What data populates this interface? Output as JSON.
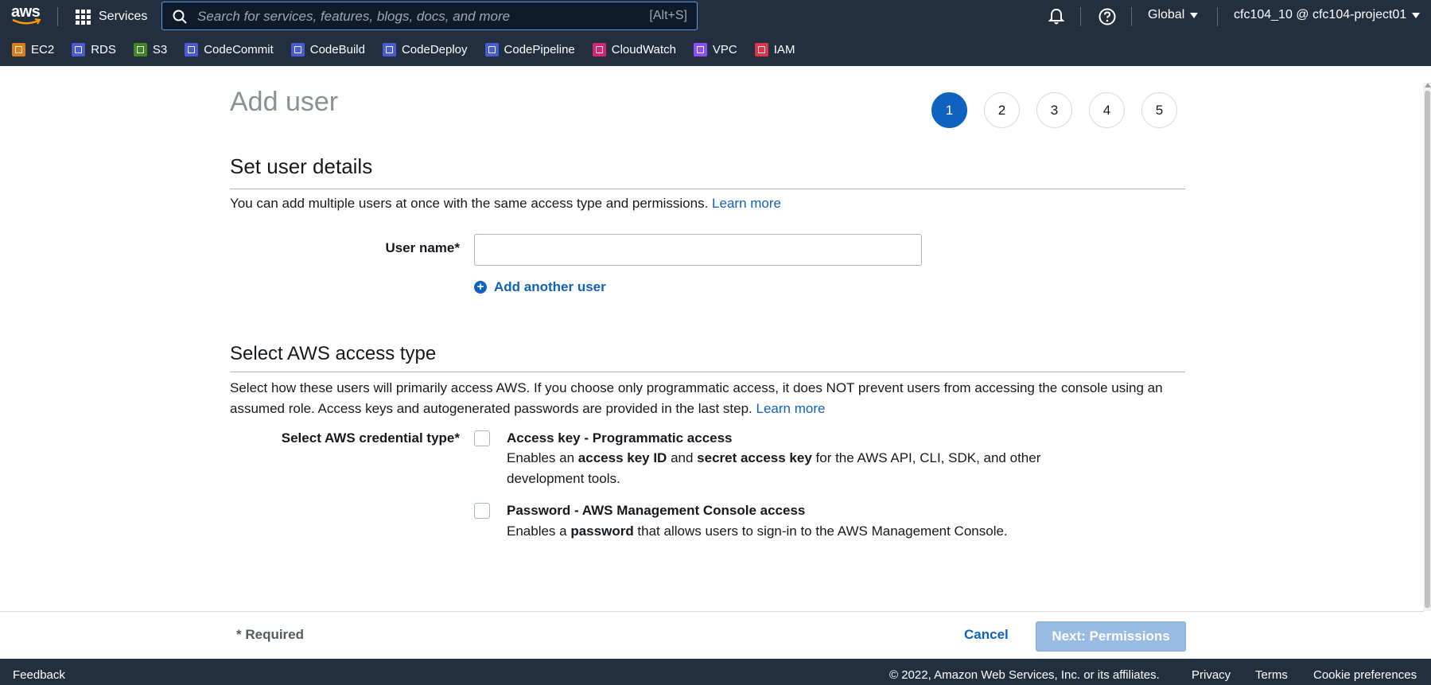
{
  "topnav": {
    "logo_text": "aws",
    "services_label": "Services",
    "search_placeholder": "Search for services, features, blogs, docs, and more",
    "search_shortcut": "[Alt+S]",
    "region": "Global",
    "account": "cfc104_10 @ cfc104-project01"
  },
  "favorites": [
    {
      "label": "EC2",
      "color": "#e07b1a"
    },
    {
      "label": "RDS",
      "color": "#4a5bd8"
    },
    {
      "label": "S3",
      "color": "#3f8624"
    },
    {
      "label": "CodeCommit",
      "color": "#4a5bd8"
    },
    {
      "label": "CodeBuild",
      "color": "#4a5bd8"
    },
    {
      "label": "CodeDeploy",
      "color": "#4a5bd8"
    },
    {
      "label": "CodePipeline",
      "color": "#4a5bd8"
    },
    {
      "label": "CloudWatch",
      "color": "#d6246e"
    },
    {
      "label": "VPC",
      "color": "#8c4fff"
    },
    {
      "label": "IAM",
      "color": "#dd344c"
    }
  ],
  "page": {
    "title": "Add user",
    "steps": [
      "1",
      "2",
      "3",
      "4",
      "5"
    ],
    "active_step": "1"
  },
  "user_details": {
    "heading": "Set user details",
    "description": "You can add multiple users at once with the same access type and permissions.",
    "learn_more": "Learn more",
    "username_label": "User name*",
    "username_value": "",
    "add_another": "Add another user"
  },
  "access_type": {
    "heading": "Select AWS access type",
    "description": "Select how these users will primarily access AWS. If you choose only programmatic access, it does NOT prevent users from accessing the console using an assumed role. Access keys and autogenerated passwords are provided in the last step.",
    "learn_more": "Learn more",
    "credential_label": "Select AWS credential type*",
    "options": [
      {
        "title": "Access key - Programmatic access",
        "desc_1": "Enables an ",
        "bold_1": "access key ID",
        "desc_2": " and ",
        "bold_2": "secret access key",
        "desc_3": " for the AWS API, CLI, SDK, and other development tools.",
        "checked": false
      },
      {
        "title": "Password - AWS Management Console access",
        "desc_1": "Enables a ",
        "bold_1": "password",
        "desc_2": " that allows users to sign-in to the AWS Management Console.",
        "checked": false
      }
    ]
  },
  "footer": {
    "required": "* Required",
    "cancel": "Cancel",
    "next": "Next: Permissions"
  },
  "bottom": {
    "feedback": "Feedback",
    "copyright": "© 2022, Amazon Web Services, Inc. or its affiliates.",
    "privacy": "Privacy",
    "terms": "Terms",
    "cookies": "Cookie preferences"
  },
  "colors": {
    "nav_bg": "#232f3e",
    "link": "#0f62be",
    "active_step": "#0f62be",
    "disabled_primary": "#99bbe3"
  }
}
